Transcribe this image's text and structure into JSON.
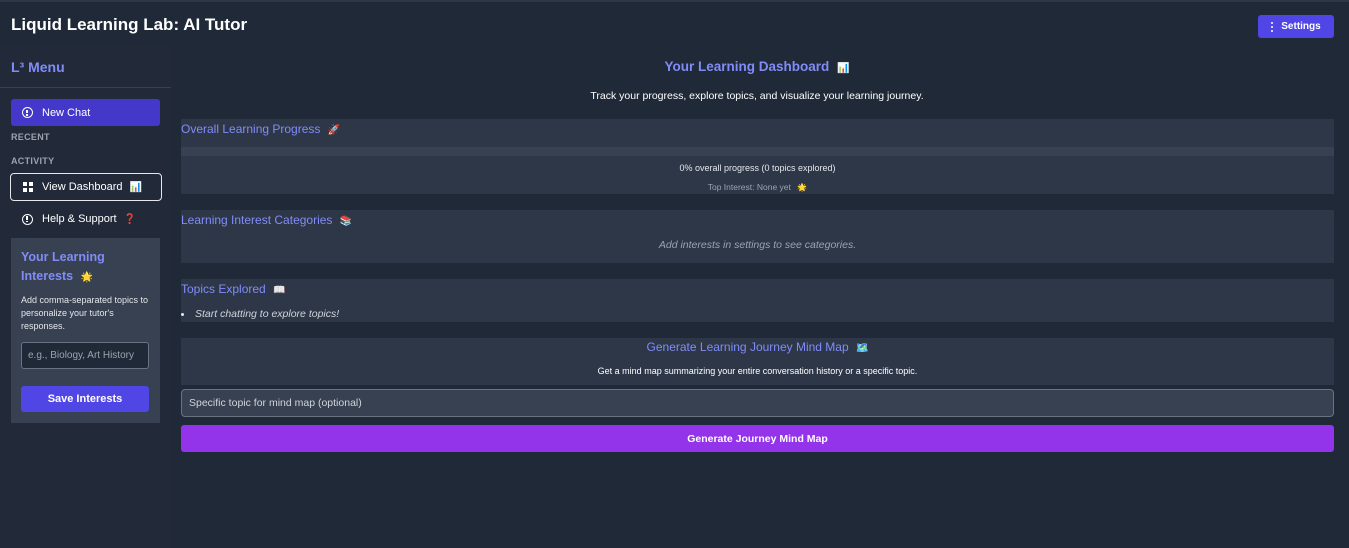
{
  "app": {
    "title": "Liquid Learning Lab: AI Tutor"
  },
  "header": {
    "settings_label": "Settings",
    "settings_icon": "vertical-dots-icon"
  },
  "sidebar": {
    "title": "L³ Menu",
    "new_chat_label": "New Chat",
    "recent_label": "RECENT",
    "activity_label": "ACTIVITY",
    "view_dashboard_label": "View Dashboard",
    "view_dashboard_emoji": "📊",
    "help_label": "Help & Support",
    "help_emoji": "❓",
    "interests": {
      "title": "Your Learning Interests",
      "title_emoji": "🌟",
      "description": "Add comma-separated topics to personalize your tutor's responses.",
      "placeholder": "e.g., Biology, Art History",
      "save_label": "Save Interests"
    }
  },
  "dashboard": {
    "title": "Your Learning Dashboard",
    "title_emoji": "📊",
    "subtitle": "Track your progress, explore topics, and visualize your learning journey.",
    "progress": {
      "title": "Overall Learning Progress",
      "title_emoji": "🚀",
      "value_percent": 0,
      "text": "0% overall progress (0 topics explored)",
      "top_interest": "Top Interest: None yet",
      "top_interest_emoji": "🌟"
    },
    "categories": {
      "title": "Learning Interest Categories",
      "title_emoji": "📚",
      "empty_text": "Add interests in settings to see categories."
    },
    "topics": {
      "title": "Topics Explored",
      "title_emoji": "📖",
      "items": [
        "Start chatting to explore topics!"
      ]
    },
    "mind_map": {
      "title": "Generate Learning Journey Mind Map",
      "title_emoji": "🗺️",
      "description": "Get a mind map summarizing your entire conversation history or a specific topic.",
      "input_placeholder": "Specific topic for mind map (optional)",
      "button_label": "Generate Journey Mind Map"
    }
  },
  "colors": {
    "accent": "#818cf8",
    "primary_button": "#4f46e5",
    "generate_button": "#9333ea",
    "background": "#1f2937",
    "card": "#2d3748"
  }
}
